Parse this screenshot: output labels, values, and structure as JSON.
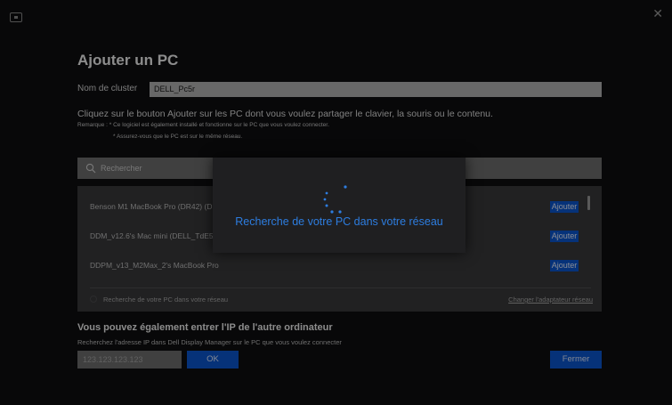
{
  "window": {
    "app_icon": "monitor-icon",
    "close_icon": "close-icon",
    "close_glyph": "✕"
  },
  "page": {
    "title": "Ajouter un PC"
  },
  "cluster": {
    "label": "Nom de cluster",
    "value": "DELL_Pc5r"
  },
  "instructions": {
    "main": "Cliquez sur le bouton Ajouter sur les PC dont vous voulez partager le clavier, la souris ou le contenu.",
    "note1": "Remarque :  * Ce logiciel est également installé et fonctionne sur le PC que vous voulez connecter.",
    "note2": "* Assurez-vous que le PC est sur le même réseau."
  },
  "search": {
    "placeholder": "Rechercher",
    "icon": "search-icon"
  },
  "devices": [
    {
      "name": "Benson M1 MacBook Pro (DR42) (DELL_P",
      "action": "Ajouter"
    },
    {
      "name": "DDM_v12.6's Mac mini (DELL_TdE5)",
      "action": "Ajouter"
    },
    {
      "name": "DDPM_v13_M2Max_2's MacBook Pro",
      "action": "Ajouter"
    }
  ],
  "list_footer": {
    "status": "Recherche de votre PC dans votre réseau",
    "change_adapter": "Changer l'adaptateur réseau"
  },
  "ip_section": {
    "heading": "Vous pouvez également entrer l'IP de l'autre ordinateur",
    "subtext": "Recherchez l'adresse IP dans Dell Display Manager sur le PC que vous voulez connecter",
    "placeholder": "123.123.123.123",
    "ok_label": "OK"
  },
  "footer": {
    "close_label": "Fermer"
  },
  "loading": {
    "text": "Recherche de votre PC dans votre réseau",
    "icon": "loading-spinner-icon"
  },
  "colors": {
    "accent": "#0b57d0",
    "loading_text": "#2d7de0",
    "background": "#0f0f11",
    "panel": "#3a3a3c"
  }
}
